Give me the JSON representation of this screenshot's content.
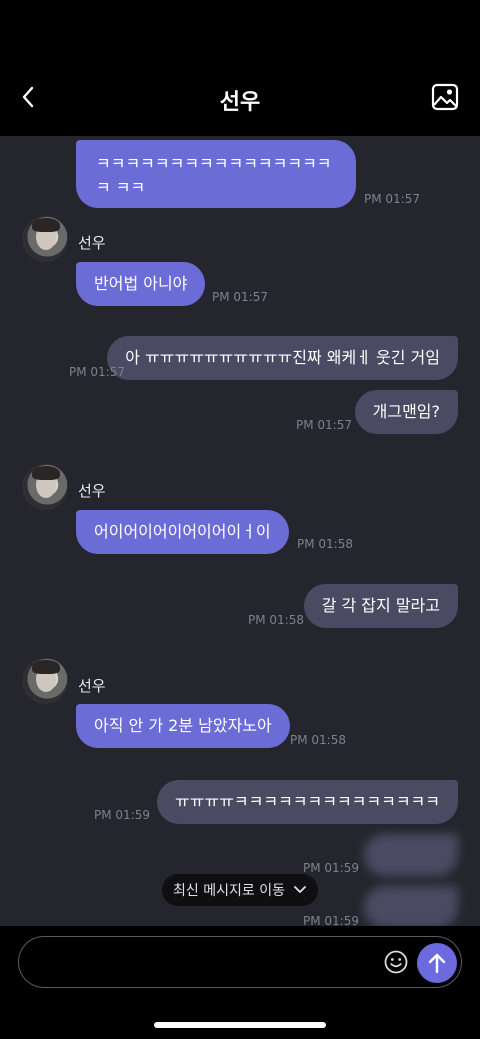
{
  "header": {
    "title": "선우"
  },
  "messages": [
    {
      "text": "ㅋㅋㅋㅋㅋㅋㅋㅋㅋㅋㅋㅋㅋㅋㅋㅋㅋ ㅋㅋ",
      "time": "PM 01:57"
    },
    {
      "sender": "선우",
      "text": "반어법 아니야",
      "time": "PM 01:57"
    },
    {
      "text": "아 ㅠㅠㅠㅠㅠㅠㅠㅠㅠㅠ진짜 왜케ㅔ 웃긴 거임",
      "time": "PM 01:57"
    },
    {
      "text": "개그맨임?",
      "time": "PM 01:57"
    },
    {
      "sender": "선우",
      "text": "어이어이어이어이어이ㅓ이",
      "time": "PM 01:58"
    },
    {
      "text": "갈 각 잡지 말라고",
      "time": "PM 01:58"
    },
    {
      "sender": "선우",
      "text": "아직 안 가 2분 남았자노아",
      "time": "PM 01:58"
    },
    {
      "text": "ㅠㅠㅠㅠㅋㅋㅋㅋㅋㅋㅋㅋㅋㅋㅋㅋㅋㅋ",
      "time": "PM 01:59"
    },
    {
      "text": "",
      "time": "PM 01:59"
    },
    {
      "text": "",
      "time": "PM 01:59"
    }
  ],
  "jump_button": {
    "label": "최신 메시지로 이동"
  },
  "composer": {
    "placeholder": ""
  },
  "colors": {
    "received_bubble": "#6c6cd6",
    "sent_bubble": "#4a4b63",
    "background": "#25252d",
    "send_button": "#6d6ae0"
  }
}
